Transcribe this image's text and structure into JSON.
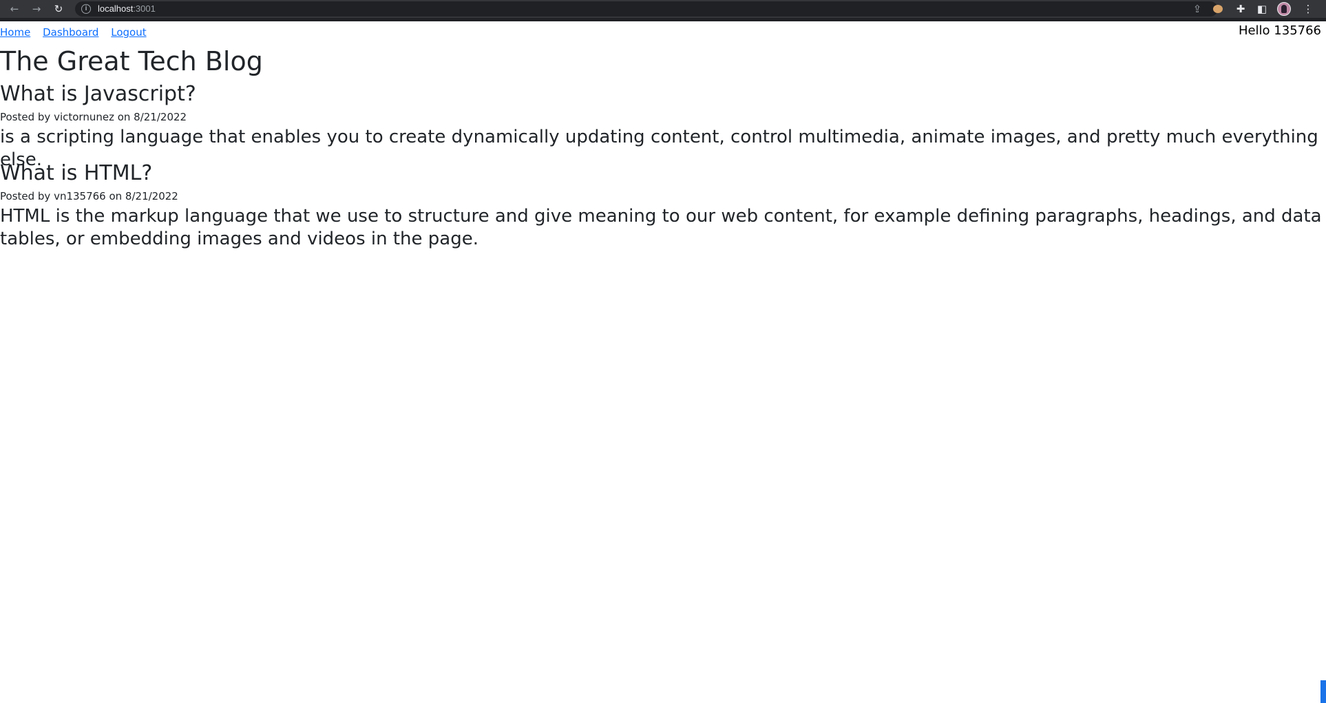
{
  "browser": {
    "url_host": "localhost",
    "url_port": ":3001",
    "icons": [
      "back-icon",
      "forward-icon",
      "reload-icon",
      "info-icon",
      "share-icon",
      "star-icon",
      "extension-icon",
      "puzzle-icon",
      "sidebar-icon",
      "avatar",
      "menu-icon"
    ]
  },
  "nav": {
    "home_label": "Home",
    "dashboard_label": "Dashboard",
    "logout_label": "Logout",
    "greeting": "Hello 135766"
  },
  "blog": {
    "title": "The Great Tech Blog",
    "posts": [
      {
        "title": "What is Javascript?",
        "meta": "Posted by victornunez on 8/21/2022",
        "body": "is a scripting language that enables you to create dynamically updating content, control multimedia, animate images, and pretty much everything else."
      },
      {
        "title": "What is HTML?",
        "meta": "Posted by vn135766 on 8/21/2022",
        "body": "HTML is the markup language that we use to structure and give meaning to our web content, for example defining paragraphs, headings, and data tables, or embedding images and videos in the page."
      }
    ]
  },
  "colors": {
    "link": "#0d6efd",
    "toolbar": "#35363a",
    "text": "#212529"
  }
}
